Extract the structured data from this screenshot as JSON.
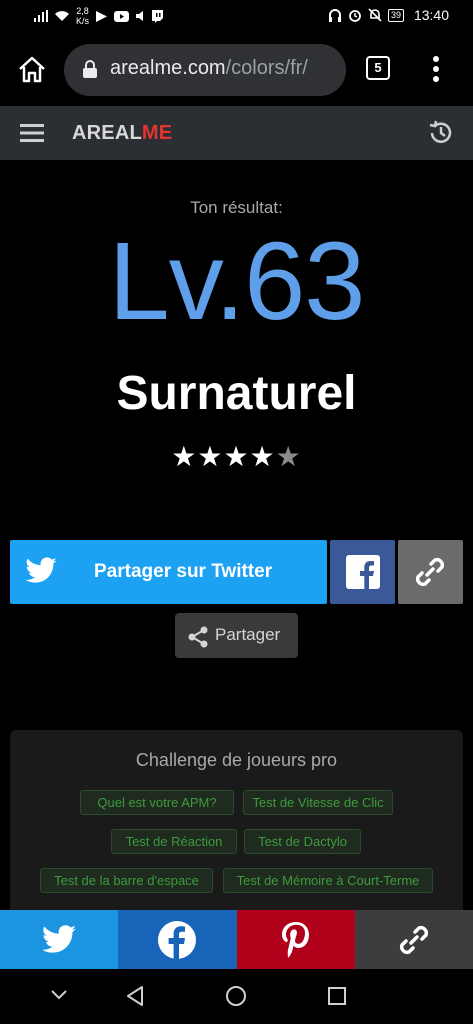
{
  "status_bar": {
    "net_speed_value": "2,8",
    "net_speed_unit": "K/s",
    "battery": "39",
    "time": "13:40"
  },
  "browser": {
    "url_host": "arealme.com",
    "url_path": "/colors/fr/",
    "tab_count": "5"
  },
  "site_header": {
    "logo_part1": "AREAL",
    "logo_part2": "ME"
  },
  "result": {
    "label": "Ton résultat:",
    "level": "Lv.63",
    "rank": "Surnaturel",
    "stars_filled": 4,
    "stars_total": 5
  },
  "share": {
    "twitter_label": "Partager sur Twitter",
    "share_label": "Partager"
  },
  "pro_challenge": {
    "title": "Challenge de joueurs pro",
    "tags": [
      "Quel est votre APM?",
      "Test de Vitesse de Clic",
      "Test de Réaction",
      "Test de Dactylo",
      "Test de la barre d'espace",
      "Test de Mémoire à Court-Terme"
    ]
  },
  "colors": {
    "level": "#5f9ee8",
    "twitter": "#1da1f2",
    "facebook": "#3b5998",
    "pinterest": "#b0001a",
    "logo_accent": "#e3342f"
  }
}
